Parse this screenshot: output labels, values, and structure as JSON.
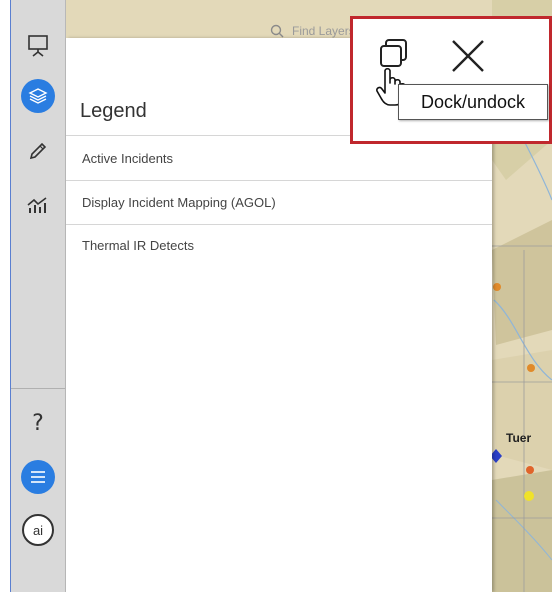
{
  "search": {
    "placeholder": "Find Layers & Pla"
  },
  "panel": {
    "title": "Legend",
    "items": [
      {
        "label": "Active Incidents"
      },
      {
        "label": "Display Incident Mapping (AGOL)"
      },
      {
        "label": "Thermal IR Detects"
      }
    ]
  },
  "controls": {
    "tooltip": "Dock/undock"
  },
  "toolbar": {
    "tools": [
      {
        "icon": "presentation-icon"
      },
      {
        "icon": "layers-icon",
        "active": true
      },
      {
        "icon": "pencil-icon"
      },
      {
        "icon": "chart-icon"
      }
    ],
    "bottom": [
      {
        "icon": "help-icon",
        "label": "?"
      },
      {
        "icon": "list-icon",
        "active": true
      },
      {
        "icon": "ai-icon",
        "label": "ai"
      }
    ]
  },
  "map": {
    "place_label": "Tuer"
  },
  "colors": {
    "accent": "#2a7de1",
    "highlight": "#c0282d",
    "map_base": "#e3d9b9"
  }
}
